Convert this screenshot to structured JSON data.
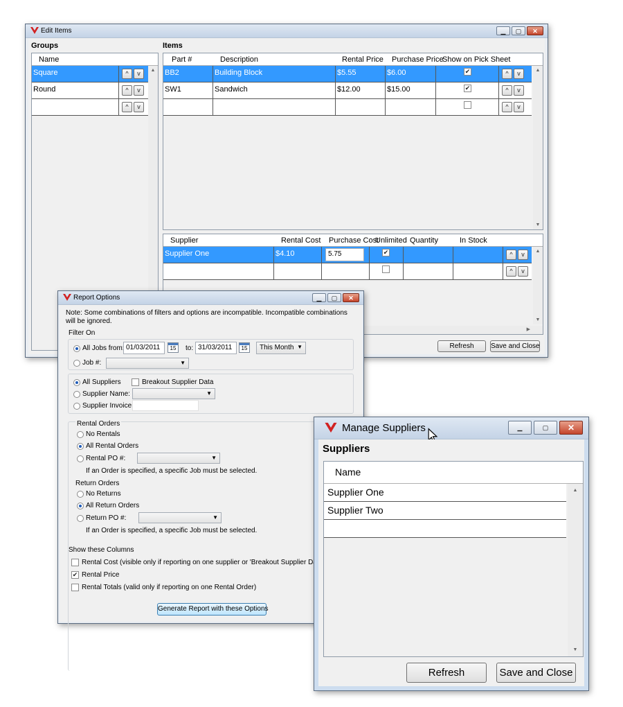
{
  "edit_items": {
    "title": "Edit Items",
    "groups_label": "Groups",
    "items_label": "Items",
    "groups_header": "Name",
    "groups": [
      "Square",
      "Round",
      ""
    ],
    "items_headers": [
      "Part #",
      "Description",
      "Rental Price",
      "Purchase Price",
      "Show on Pick Sheet"
    ],
    "items": [
      {
        "part": "BB2",
        "desc": "Building Block",
        "rental": "$5.55",
        "purchase": "$6.00",
        "show": true
      },
      {
        "part": "SW1",
        "desc": "Sandwich",
        "rental": "$12.00",
        "purchase": "$15.00",
        "show": true
      },
      {
        "part": "",
        "desc": "",
        "rental": "",
        "purchase": "",
        "show": false
      }
    ],
    "supplier_headers": [
      "Supplier",
      "Rental Cost",
      "Purchase Cost",
      "Unlimited",
      "Quantity",
      "In Stock"
    ],
    "suppliers": [
      {
        "supplier": "Supplier One",
        "rental_cost": "$4.10",
        "purchase_cost": "5.75",
        "unlimited": true,
        "quantity": "",
        "in_stock": ""
      },
      {
        "supplier": "",
        "rental_cost": "",
        "purchase_cost": "",
        "unlimited": false,
        "quantity": "",
        "in_stock": ""
      }
    ],
    "refresh_label": "Refresh",
    "save_label": "Save and Close",
    "up_glyph": "^",
    "down_glyph": "v"
  },
  "report_options": {
    "title": "Report Options",
    "note": "Note: Some combinations of filters and options are incompatible.  Incompatible combinations will be ignored.",
    "filter_on": "Filter On",
    "all_jobs_from": "All Jobs from:",
    "from_date": "01/03/2011",
    "to_label": "to:",
    "to_date": "31/03/2011",
    "period": "This Month",
    "job_label": "Job #:",
    "all_suppliers": "All Suppliers",
    "breakout": "Breakout Supplier Data",
    "supplier_name": "Supplier Name:",
    "supplier_invoice": "Supplier Invoice:",
    "rental_orders": "Rental Orders",
    "no_rentals": "No Rentals",
    "all_rental_orders": "All Rental Orders",
    "rental_po": "Rental PO #:",
    "order_note": "If an Order is specified, a specific Job must be selected.",
    "return_orders": "Return Orders",
    "no_returns": "No Returns",
    "all_return_orders": "All Return Orders",
    "return_po": "Return PO #:",
    "show_columns": "Show these Columns",
    "col_rental_cost": "Rental Cost (visible only if reporting on one supplier or 'Breakout Supplier Data'",
    "col_rental_price": "Rental Price",
    "col_rental_totals": "Rental Totals (valid only if reporting on one Rental Order)",
    "generate_label": "Generate Report with these Options",
    "calendar_glyph": "15"
  },
  "manage_suppliers": {
    "title": "Manage Suppliers",
    "heading": "Suppliers",
    "header": "Name",
    "rows": [
      "Supplier One",
      "Supplier Two",
      ""
    ],
    "refresh_label": "Refresh",
    "save_label": "Save and Close"
  }
}
